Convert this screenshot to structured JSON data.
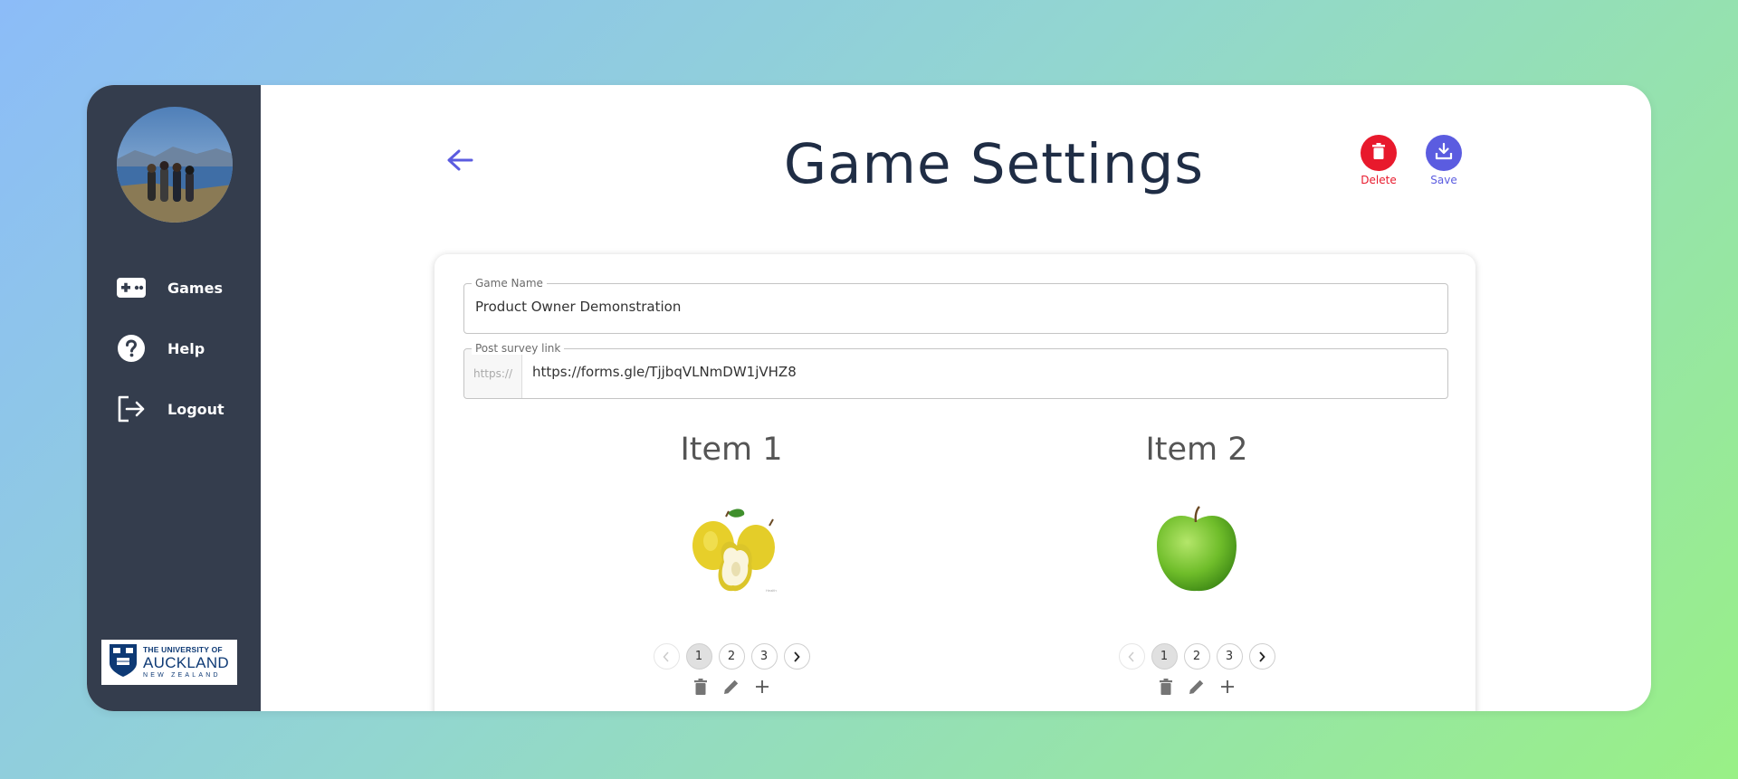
{
  "sidebar": {
    "items": [
      {
        "label": "Games",
        "icon": "gamepad-icon"
      },
      {
        "label": "Help",
        "icon": "help-circle-icon"
      },
      {
        "label": "Logout",
        "icon": "logout-icon"
      }
    ],
    "logo": {
      "line1": "THE UNIVERSITY OF",
      "line2": "AUCKLAND",
      "line3": "NEW ZEALAND"
    }
  },
  "header": {
    "title": "Game Settings",
    "delete_label": "Delete",
    "save_label": "Save"
  },
  "form": {
    "game_name": {
      "label": "Game Name",
      "value": "Product Owner Demonstration"
    },
    "survey_link": {
      "label": "Post survey link",
      "prefix": "https://",
      "value": "https://forms.gle/TjjbqVLNmDW1jVHZ8"
    }
  },
  "items": [
    {
      "title": "Item 1",
      "image": "pears",
      "pages": [
        "1",
        "2",
        "3"
      ],
      "current_page": "1"
    },
    {
      "title": "Item 2",
      "image": "green-apple",
      "pages": [
        "1",
        "2",
        "3"
      ],
      "current_page": "1"
    }
  ],
  "colors": {
    "sidebar": "#343d4d",
    "accent": "#5b5ce0",
    "delete": "#e8192c",
    "title": "#1f2d45"
  }
}
